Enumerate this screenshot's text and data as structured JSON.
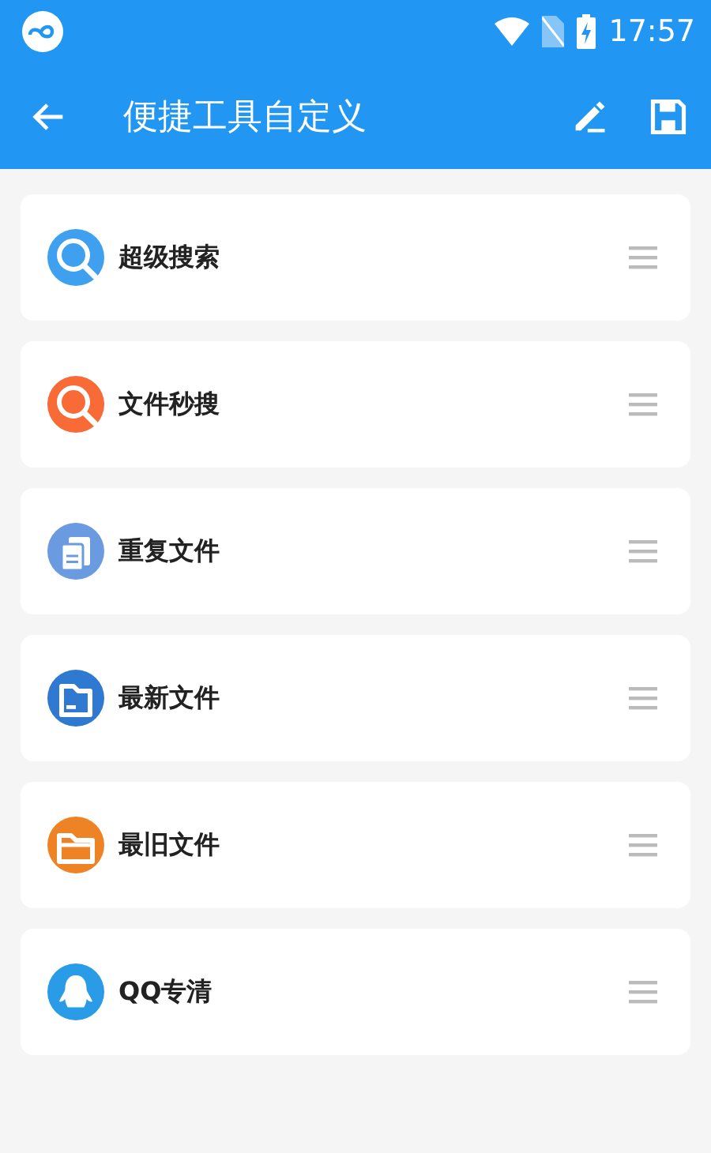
{
  "status_bar": {
    "time": "17:57"
  },
  "app_bar": {
    "title": "便捷工具自定义"
  },
  "tools": [
    {
      "label": "超级搜索",
      "kind": "search",
      "color": "#3fa0f0"
    },
    {
      "label": "文件秒搜",
      "kind": "search",
      "color": "#f86a36"
    },
    {
      "label": "重复文件",
      "kind": "document",
      "color": "#6a9be0"
    },
    {
      "label": "最新文件",
      "kind": "folder",
      "color": "#2f7ad0"
    },
    {
      "label": "最旧文件",
      "kind": "open-folder",
      "color": "#ee8326"
    },
    {
      "label": "QQ专清",
      "kind": "penguin",
      "color": "#2a9be6"
    }
  ]
}
